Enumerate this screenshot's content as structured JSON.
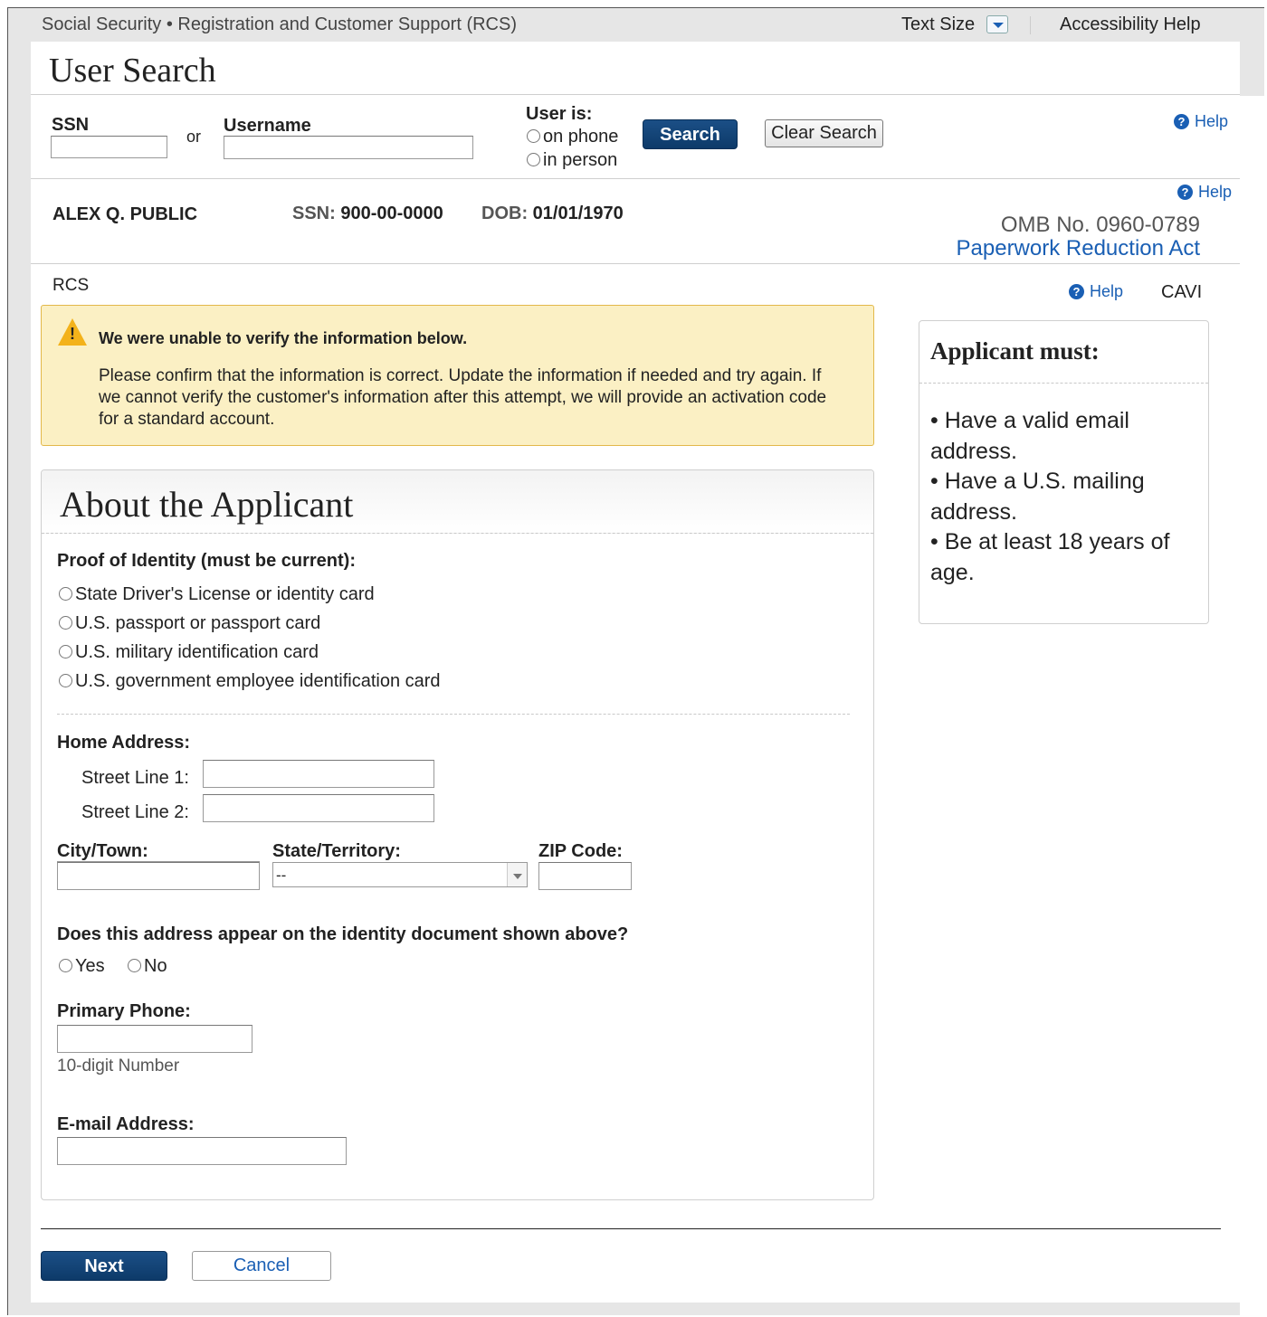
{
  "topbar": {
    "title": "Social Security • Registration and Customer Support (RCS)",
    "text_size_label": "Text Size",
    "accessibility_help": "Accessibility Help"
  },
  "search": {
    "heading": "User Search",
    "ssn_label": "SSN",
    "or_label": "or",
    "username_label": "Username",
    "user_is_label": "User is:",
    "on_phone": "on phone",
    "in_person": "in person",
    "search_button": "Search",
    "clear_button": "Clear Search",
    "help": "Help"
  },
  "applicant_bar": {
    "name": "ALEX Q. PUBLIC",
    "ssn_label": "SSN:",
    "ssn_value": "900-00-0000",
    "dob_label": "DOB:",
    "dob_value": "01/01/1970",
    "help": "Help",
    "omb": "OMB No. 0960-0789",
    "paperwork": "Paperwork Reduction Act"
  },
  "breadcrumb": "RCS",
  "right_help": "Help",
  "cavi": "CAVI",
  "alert": {
    "icon": "warning-icon",
    "title": "We were unable to verify the information below.",
    "body": "Please confirm that the information is correct. Update the information if needed and try again. If we cannot verify the customer's information after this attempt, we will provide an activation code for a standard account."
  },
  "form": {
    "title": "About the Applicant",
    "proof_label": "Proof of Identity (must be current):",
    "proof_options": [
      "State Driver's License or identity card",
      "U.S. passport or passport card",
      "U.S. military identification card",
      "U.S. government employee identification card"
    ],
    "home_address_label": "Home Address:",
    "street1_label": "Street Line 1:",
    "street2_label": "Street Line 2:",
    "city_label": "City/Town:",
    "state_label": "State/Territory:",
    "state_value": "--",
    "zip_label": "ZIP Code:",
    "address_question": "Does this address appear on the identity document shown above?",
    "yes": "Yes",
    "no": "No",
    "phone_label": "Primary Phone:",
    "phone_hint": "10-digit Number",
    "email_label": "E-mail Address:"
  },
  "sidebar": {
    "title": "Applicant must:",
    "items": [
      "• Have a valid email address.",
      "• Have a U.S. mailing address.",
      "• Be at least 18 years of age."
    ]
  },
  "actions": {
    "next": "Next",
    "cancel": "Cancel"
  },
  "colors": {
    "link_blue": "#1a5fb4",
    "button_navy": "#0d3a69",
    "alert_bg": "#fbf0c4"
  }
}
